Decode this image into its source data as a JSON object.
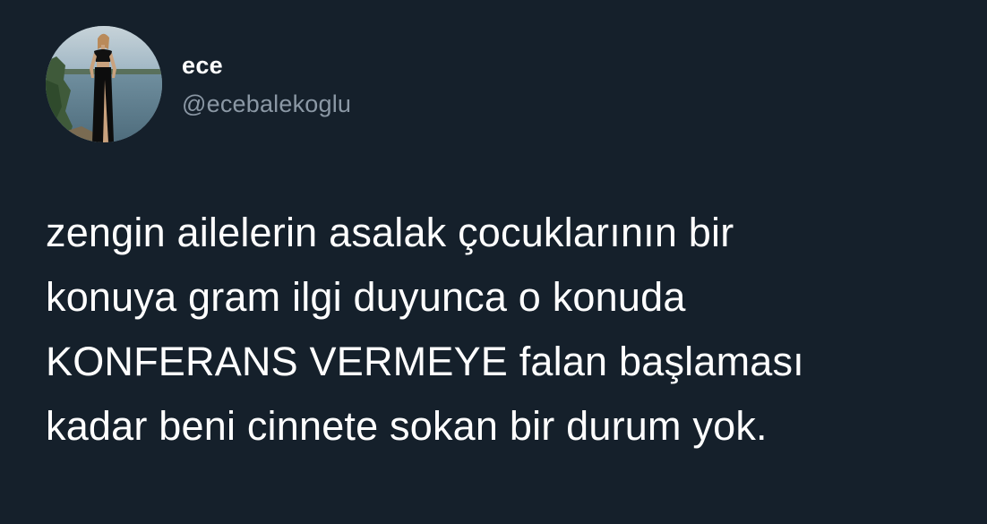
{
  "tweet": {
    "author": {
      "display_name": "ece",
      "handle": "@ecebalekoglu",
      "avatar_icon": "profile-photo-avatar"
    },
    "text": "zengin ailelerin asalak çocuklarının bir\nkonuya gram ilgi duyunca o konuda\nKONFERANS VERMEYE falan başlaması\nkadar beni cinnete sokan bir durum yok."
  },
  "colors": {
    "background": "#15202b",
    "primary_text": "#ffffff",
    "secondary_text": "#8b98a5"
  }
}
